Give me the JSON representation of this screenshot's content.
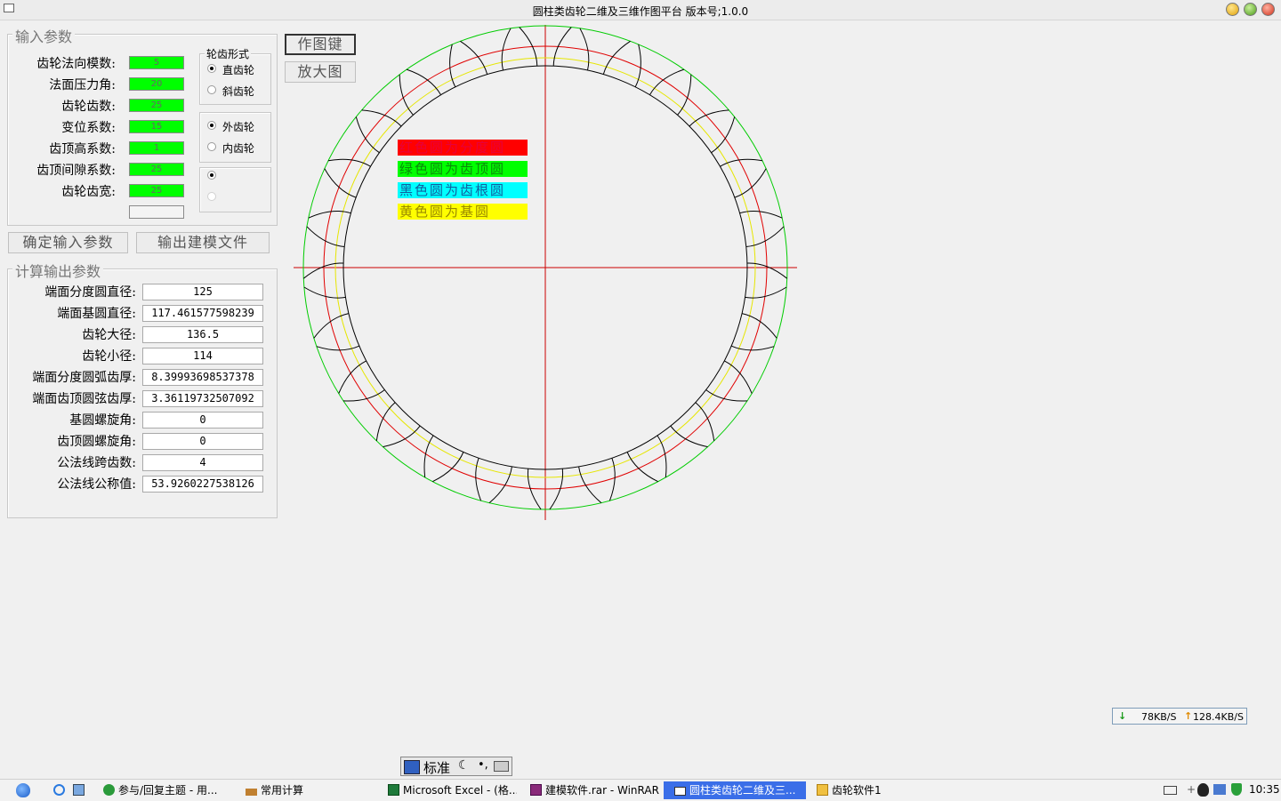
{
  "window": {
    "title": "圆柱类齿轮二维及三维作图平台 版本号;1.0.0"
  },
  "input_group": {
    "legend": "输入参数",
    "fields": [
      {
        "label": "齿轮法向模数:",
        "value": "5"
      },
      {
        "label": "法面压力角:",
        "value": "20"
      },
      {
        "label": "齿轮齿数:",
        "value": "25"
      },
      {
        "label": "变位系数:",
        "value": "15"
      },
      {
        "label": "齿顶高系数:",
        "value": "1"
      },
      {
        "label": "齿顶间隙系数:",
        "value": "25"
      },
      {
        "label": "齿轮齿宽:",
        "value": "25"
      }
    ],
    "extra_value": ""
  },
  "gear_form": {
    "legend": "轮齿形式",
    "options": [
      "直齿轮",
      "斜齿轮"
    ],
    "selected": "直齿轮"
  },
  "gear_type": {
    "options": [
      "外齿轮",
      "内齿轮"
    ],
    "selected": "外齿轮"
  },
  "buttons": {
    "confirm": "确定输入参数",
    "export": "输出建模文件",
    "draw": "作图键",
    "zoom": "放大图"
  },
  "output_group": {
    "legend": "计算输出参数",
    "fields": [
      {
        "label": "端面分度圆直径:",
        "value": "125"
      },
      {
        "label": "端面基圆直径:",
        "value": "117.461577598239"
      },
      {
        "label": "齿轮大径:",
        "value": "136.5"
      },
      {
        "label": "齿轮小径:",
        "value": "114"
      },
      {
        "label": "端面分度圆弧齿厚:",
        "value": "8.39993698537378"
      },
      {
        "label": "端面齿顶圆弦齿厚:",
        "value": "3.36119732507092"
      },
      {
        "label": "基圆螺旋角:",
        "value": "0"
      },
      {
        "label": "齿顶圆螺旋角:",
        "value": "0"
      },
      {
        "label": "公法线跨齿数:",
        "value": "4"
      },
      {
        "label": "公法线公称值:",
        "value": "53.9260227538126"
      }
    ]
  },
  "legend": {
    "items": [
      {
        "text": "红色圆为分度圆",
        "color": "#ff0000"
      },
      {
        "text": "绿色圆为齿顶圆",
        "color": "#00ff00"
      },
      {
        "text": "黑色圆为齿根圆",
        "color": "#00ffff"
      },
      {
        "text": "黄色圆为基圆",
        "color": "#ffff00"
      }
    ]
  },
  "drawing": {
    "teeth": 25,
    "addendum_color": "#00cc00",
    "pitch_color": "#e00000",
    "base_color": "#e6e600",
    "root_color": "#000000",
    "axis_color": "#cc0000"
  },
  "netspeed": {
    "down": "78KB/S",
    "up": "128.4KB/S"
  },
  "ime": {
    "mode": "标准"
  },
  "taskbar": {
    "items": [
      "参与/回复主题 - 用...",
      "常用计算",
      "Microsoft Excel - (格...",
      "建模软件.rar - WinRAR",
      "圆柱类齿轮二维及三...",
      "齿轮软件1"
    ],
    "active_index": 4,
    "clock": "10:35"
  }
}
